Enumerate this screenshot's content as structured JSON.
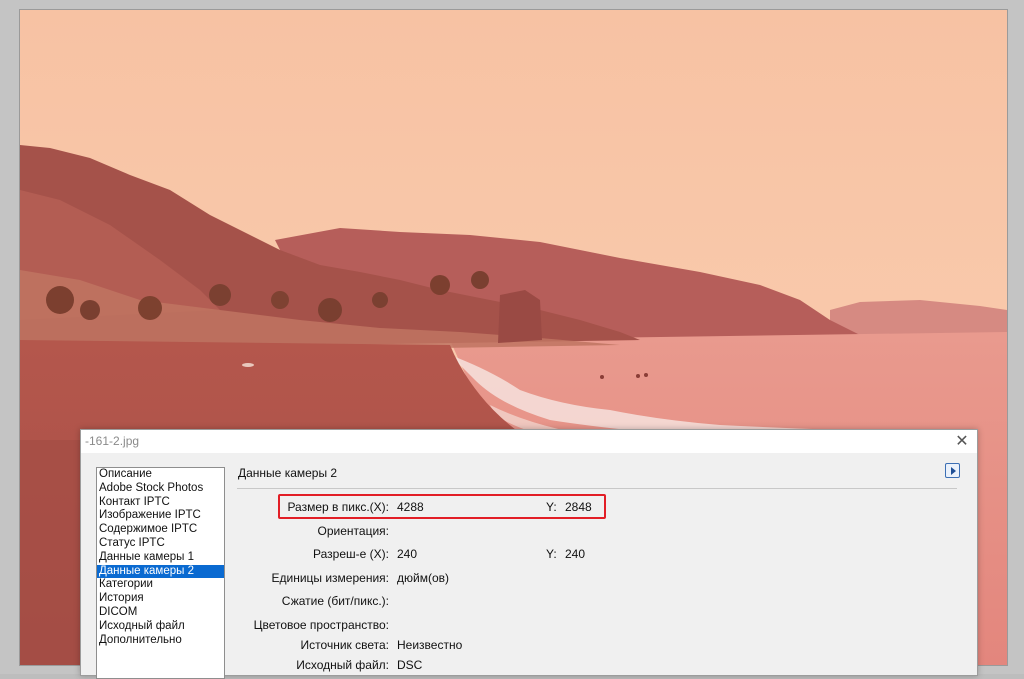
{
  "dialog": {
    "title": "-161-2.jpg",
    "close_glyph": "✕"
  },
  "categories": {
    "items": [
      {
        "label": "Описание",
        "selected": false
      },
      {
        "label": "Adobe Stock Photos",
        "selected": false
      },
      {
        "label": "Контакт IPTC",
        "selected": false
      },
      {
        "label": "Изображение IPTC",
        "selected": false
      },
      {
        "label": "Содержимое IPTC",
        "selected": false
      },
      {
        "label": "Статус IPTC",
        "selected": false
      },
      {
        "label": "Данные камеры 1",
        "selected": false
      },
      {
        "label": "Данные камеры 2",
        "selected": true
      },
      {
        "label": "Категории",
        "selected": false
      },
      {
        "label": "История",
        "selected": false
      },
      {
        "label": "DICOM",
        "selected": false
      },
      {
        "label": "Исходный файл",
        "selected": false
      },
      {
        "label": "Дополнительно",
        "selected": false
      }
    ]
  },
  "panel": {
    "title": "Данные камеры 2",
    "menu_icon": "flyout-menu-icon",
    "fields": {
      "pixel_x_label": "Размер в пикс.(X):",
      "pixel_x_value": "4288",
      "pixel_y_label": "Y:",
      "pixel_y_value": "2848",
      "orientation_label": "Ориентация:",
      "orientation_value": "",
      "resolution_x_label": "Разреш-е (X):",
      "resolution_x_value": "240",
      "resolution_y_label": "Y:",
      "resolution_y_value": "240",
      "units_label": "Единицы измерения:",
      "units_value": "дюйм(ов)",
      "compression_label": "Сжатие (бит/пикс.):",
      "compression_value": "",
      "colorspace_label": "Цветовое пространство:",
      "colorspace_value": "",
      "light_source_label": "Источник света:",
      "light_source_value": "Неизвестно",
      "source_file_label": "Исходный файл:",
      "source_file_value": "DSC"
    }
  },
  "colors": {
    "selection": "#0a6ad1",
    "highlight": "#e21e26",
    "sky": "#f6c3a6",
    "sea": "#ec9f93"
  }
}
